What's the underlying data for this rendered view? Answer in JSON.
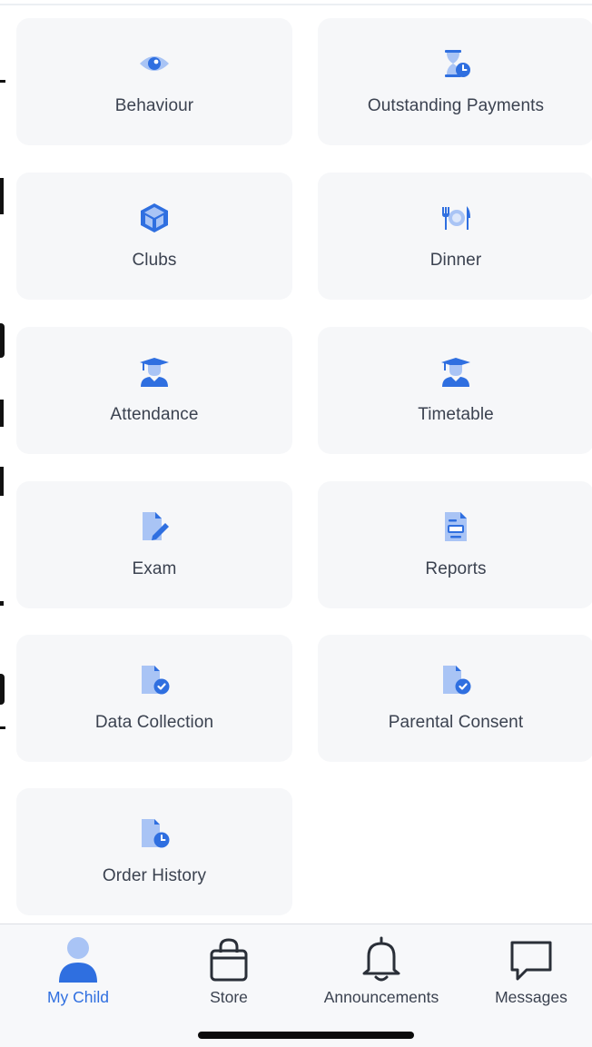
{
  "colors": {
    "accent": "#2f6fe0",
    "accent_light": "#a9c4f5",
    "tile_bg": "#f6f7f9",
    "label": "#3b4250"
  },
  "tiles": [
    {
      "label": "Behaviour",
      "icon": "eye-icon"
    },
    {
      "label": "Outstanding Payments",
      "icon": "hourglass-clock-icon"
    },
    {
      "label": "Clubs",
      "icon": "cube-icon"
    },
    {
      "label": "Dinner",
      "icon": "plate-cutlery-icon"
    },
    {
      "label": "Attendance",
      "icon": "graduate-icon"
    },
    {
      "label": "Timetable",
      "icon": "graduate-icon"
    },
    {
      "label": "Exam",
      "icon": "document-pencil-icon"
    },
    {
      "label": "Reports",
      "icon": "report-document-icon"
    },
    {
      "label": "Data Collection",
      "icon": "document-check-icon"
    },
    {
      "label": "Parental Consent",
      "icon": "document-check-icon"
    },
    {
      "label": "Order History",
      "icon": "document-clock-icon"
    }
  ],
  "tabbar": [
    {
      "label": "My Child",
      "icon": "person-icon",
      "active": true
    },
    {
      "label": "Store",
      "icon": "shopping-bag-icon",
      "active": false
    },
    {
      "label": "Announcements",
      "icon": "bell-icon",
      "active": false
    },
    {
      "label": "Messages",
      "icon": "chat-bubble-icon",
      "active": false
    }
  ]
}
